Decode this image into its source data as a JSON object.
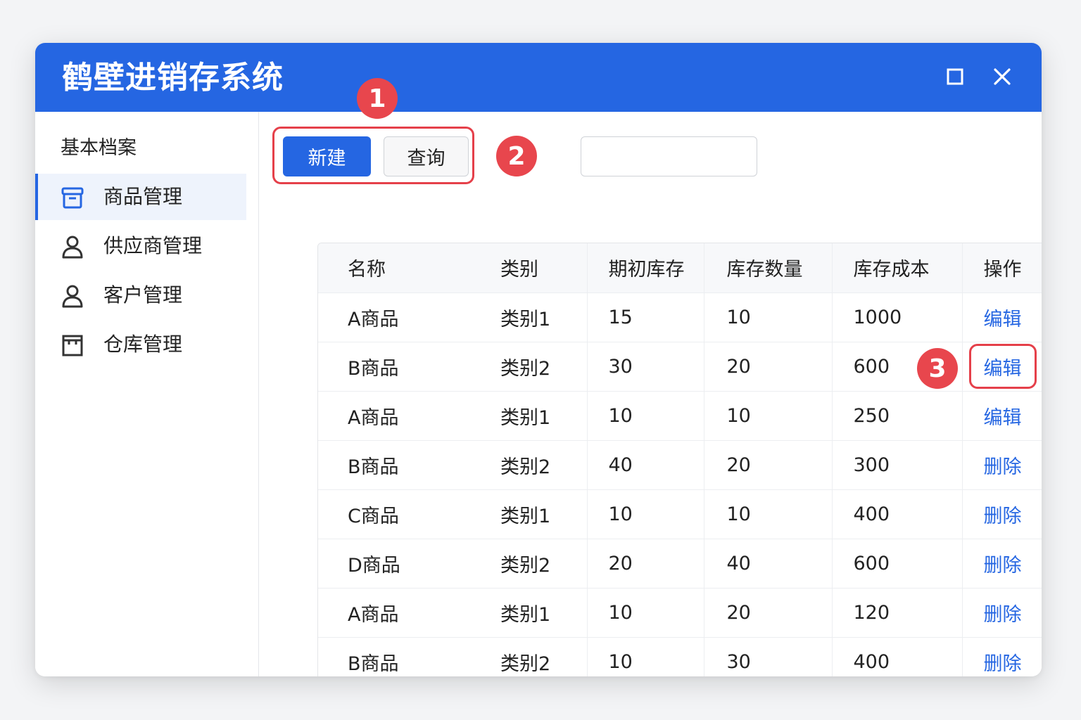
{
  "window": {
    "title": "鹤壁进销存系统"
  },
  "sidebar": {
    "heading": "基本档案",
    "items": [
      {
        "label": "商品管理",
        "icon": "archive-box-icon",
        "active": true
      },
      {
        "label": "供应商管理",
        "icon": "user-icon",
        "active": false
      },
      {
        "label": "客户管理",
        "icon": "user-icon",
        "active": false
      },
      {
        "label": "仓库管理",
        "icon": "warehouse-icon",
        "active": false
      }
    ]
  },
  "toolbar": {
    "new_label": "新建",
    "query_label": "查询",
    "search_value": ""
  },
  "callouts": [
    "1",
    "2",
    "3"
  ],
  "table": {
    "headers": [
      "名称",
      "类别",
      "期初库存",
      "库存数量",
      "库存成本",
      "操作"
    ],
    "rows": [
      [
        "A商品",
        "类别1",
        "15",
        "10",
        "1000",
        "编辑"
      ],
      [
        "B商品",
        "类别2",
        "30",
        "20",
        "600",
        "编辑"
      ],
      [
        "A商品",
        "类别1",
        "10",
        "10",
        "250",
        "编辑"
      ],
      [
        "B商品",
        "类别2",
        "40",
        "20",
        "300",
        "删除"
      ],
      [
        "C商品",
        "类别1",
        "10",
        "10",
        "400",
        "删除"
      ],
      [
        "D商品",
        "类别2",
        "20",
        "40",
        "600",
        "删除"
      ],
      [
        "A商品",
        "类别1",
        "10",
        "20",
        "120",
        "删除"
      ],
      [
        "B商品",
        "类别2",
        "10",
        "30",
        "400",
        "删除"
      ]
    ]
  },
  "colors": {
    "primary": "#2566e2",
    "highlight": "#e5404a",
    "background": "#f3f4f6"
  }
}
